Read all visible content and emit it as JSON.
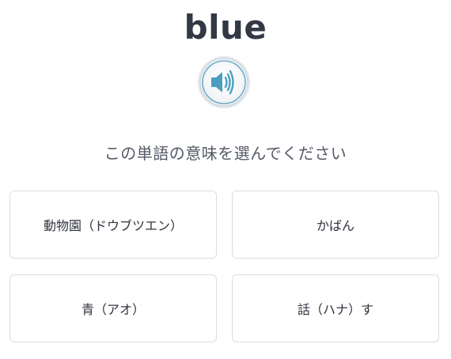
{
  "quiz": {
    "word": "blue",
    "audio_icon": "speaker-icon",
    "prompt": "この単語の意味を選んでください",
    "choices": [
      {
        "label": "動物園（ドウブツエン）"
      },
      {
        "label": "かばん"
      },
      {
        "label": "青（アオ）"
      },
      {
        "label": "話（ハナ）す"
      }
    ]
  },
  "colors": {
    "speaker_ring": "#d8dde3",
    "speaker_fill": "#4a9fc1"
  }
}
